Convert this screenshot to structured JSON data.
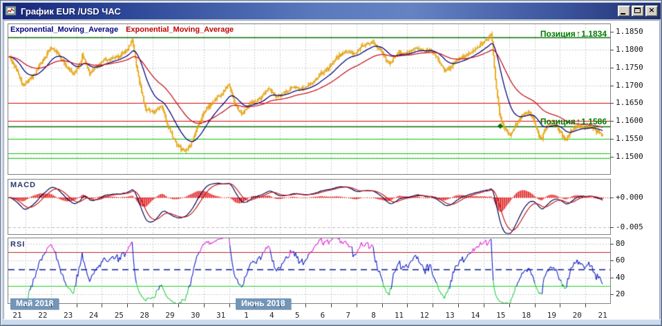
{
  "window": {
    "title": "График EUR /USD ЧАС",
    "close_glyph": "×"
  },
  "legend": {
    "ema_fast_label": "Exponential_Moving_Average",
    "ema_fast_color": "#000080",
    "ema_slow_label": "Exponential_Moving_Average",
    "ema_slow_color": "#c00000"
  },
  "positions": [
    {
      "label": "Позиция",
      "arrow": "↑",
      "price": "1.1834",
      "level": 1.1834,
      "color": "#007a00"
    },
    {
      "label": "Позиция",
      "arrow": "↑",
      "price": "1.1586",
      "level": 1.1586,
      "color": "#007a00",
      "marker": {
        "t": 19.48,
        "shape": "diamond"
      }
    }
  ],
  "chart_data": {
    "type": "candlestick",
    "instrument": "EUR/USD",
    "timeframe": "hourly",
    "title": "График EUR /USD ЧАС",
    "x_axis": {
      "day_labels": [
        "21",
        "22",
        "23",
        "24",
        "25",
        "28",
        "29",
        "30",
        "31",
        "1",
        "4",
        "5",
        "6",
        "7",
        "8",
        "11",
        "12",
        "13",
        "14",
        "15",
        "18",
        "19",
        "20",
        "21"
      ],
      "month_badges": [
        {
          "label": "Май 2018"
        },
        {
          "label": "Июнь 2018"
        }
      ]
    },
    "price_axis": {
      "tick_labels": [
        "1.1850",
        "1.1800",
        "1.1750",
        "1.1700",
        "1.1650",
        "1.1600",
        "1.1550",
        "1.1500"
      ],
      "tick_values": [
        1.185,
        1.18,
        1.175,
        1.17,
        1.165,
        1.16,
        1.155,
        1.15
      ],
      "min_visible": 1.1454,
      "max_visible": 1.1873
    },
    "grid_prices": [
      1.18,
      1.175,
      1.17,
      1.165,
      1.16,
      1.155,
      1.15
    ],
    "hlines": [
      {
        "price": 1.1834,
        "color": "#006b00",
        "width": 1.4
      },
      {
        "price": 1.165,
        "color": "#d40000",
        "width": 1
      },
      {
        "price": 1.1601,
        "color": "#d40000",
        "width": 1
      },
      {
        "price": 1.1586,
        "color": "#006b00",
        "width": 1.4
      },
      {
        "price": 1.1551,
        "color": "#00ca00",
        "width": 1.2
      },
      {
        "price": 1.1509,
        "color": "#00ca00",
        "width": 1.2
      },
      {
        "price": 1.1497,
        "color": "#00ca00",
        "width": 1.2
      }
    ],
    "candle_count": 560,
    "t_start": 0.17,
    "t_end": 23.5,
    "noise_amplitude": 0.0006,
    "wick_amplitude": 0.0007,
    "price_path_waypoints": [
      [
        0.17,
        1.178
      ],
      [
        0.45,
        1.1745
      ],
      [
        0.74,
        1.17
      ],
      [
        0.95,
        1.1716
      ],
      [
        1.2,
        1.1732
      ],
      [
        1.55,
        1.1776
      ],
      [
        1.8,
        1.1806
      ],
      [
        2.1,
        1.179
      ],
      [
        2.4,
        1.1756
      ],
      [
        2.7,
        1.173
      ],
      [
        2.95,
        1.1756
      ],
      [
        3.05,
        1.1788
      ],
      [
        3.35,
        1.1732
      ],
      [
        3.6,
        1.1752
      ],
      [
        3.9,
        1.1772
      ],
      [
        4.2,
        1.1776
      ],
      [
        4.5,
        1.178
      ],
      [
        4.8,
        1.1796
      ],
      [
        5.01,
        1.183
      ],
      [
        5.17,
        1.1758
      ],
      [
        5.36,
        1.169
      ],
      [
        5.55,
        1.1632
      ],
      [
        5.88,
        1.1626
      ],
      [
        6.15,
        1.1645
      ],
      [
        6.36,
        1.16
      ],
      [
        6.58,
        1.156
      ],
      [
        6.8,
        1.1532
      ],
      [
        7.07,
        1.1514
      ],
      [
        7.34,
        1.1536
      ],
      [
        7.61,
        1.1586
      ],
      [
        7.88,
        1.163
      ],
      [
        8.16,
        1.1652
      ],
      [
        8.48,
        1.1672
      ],
      [
        8.81,
        1.1702
      ],
      [
        9.08,
        1.1642
      ],
      [
        9.35,
        1.1618
      ],
      [
        9.68,
        1.1655
      ],
      [
        10.03,
        1.166
      ],
      [
        10.38,
        1.1692
      ],
      [
        10.71,
        1.1666
      ],
      [
        11.03,
        1.168
      ],
      [
        11.36,
        1.1696
      ],
      [
        11.69,
        1.169
      ],
      [
        12.07,
        1.1706
      ],
      [
        12.39,
        1.173
      ],
      [
        12.75,
        1.1752
      ],
      [
        13.1,
        1.178
      ],
      [
        13.42,
        1.1796
      ],
      [
        13.75,
        1.1786
      ],
      [
        14.08,
        1.1812
      ],
      [
        14.46,
        1.1822
      ],
      [
        14.78,
        1.1796
      ],
      [
        15.11,
        1.176
      ],
      [
        15.46,
        1.1792
      ],
      [
        15.81,
        1.1788
      ],
      [
        16.14,
        1.1806
      ],
      [
        16.47,
        1.1796
      ],
      [
        16.82,
        1.1795
      ],
      [
        17.05,
        1.177
      ],
      [
        17.3,
        1.174
      ],
      [
        17.6,
        1.1756
      ],
      [
        17.85,
        1.1776
      ],
      [
        18.1,
        1.1782
      ],
      [
        18.45,
        1.18
      ],
      [
        18.72,
        1.1816
      ],
      [
        18.99,
        1.183
      ],
      [
        19.13,
        1.1846
      ],
      [
        19.23,
        1.1762
      ],
      [
        19.34,
        1.168
      ],
      [
        19.45,
        1.162
      ],
      [
        19.56,
        1.1592
      ],
      [
        19.72,
        1.157
      ],
      [
        19.89,
        1.156
      ],
      [
        20.08,
        1.1592
      ],
      [
        20.35,
        1.1616
      ],
      [
        20.62,
        1.1626
      ],
      [
        20.81,
        1.16
      ],
      [
        20.97,
        1.1562
      ],
      [
        21.08,
        1.1546
      ],
      [
        21.24,
        1.158
      ],
      [
        21.46,
        1.1592
      ],
      [
        21.71,
        1.1586
      ],
      [
        21.9,
        1.156
      ],
      [
        22.06,
        1.1546
      ],
      [
        22.25,
        1.1572
      ],
      [
        22.52,
        1.1586
      ],
      [
        22.79,
        1.158
      ],
      [
        22.98,
        1.1589
      ],
      [
        23.15,
        1.1576
      ],
      [
        23.36,
        1.1566
      ],
      [
        23.5,
        1.156
      ]
    ],
    "ema": {
      "fast_period": 21,
      "slow_period": 55,
      "fast_color": "#00007d",
      "slow_color": "#c41420"
    },
    "macd": {
      "label": "MACD",
      "tick_labels": [
        "+0.000",
        "-0.005"
      ],
      "tick_values": [
        0,
        -0.005
      ],
      "fast": 12,
      "slow": 26,
      "signal": 9,
      "line_color": "#000050",
      "signal_color": "#c01818",
      "hist_color": "#dd0000",
      "zero_line_color": "#dd0000"
    },
    "rsi": {
      "label": "RSI",
      "period": 14,
      "tick_labels": [
        "80",
        "60",
        "40",
        "20"
      ],
      "tick_values": [
        80,
        60,
        40,
        20
      ],
      "levels": [
        {
          "value": 70,
          "color": "#b42222",
          "style": "solid"
        },
        {
          "value": 50,
          "color": "#00148c",
          "style": "dash"
        },
        {
          "value": 30,
          "color": "#22cc22",
          "style": "solid"
        }
      ],
      "line_color": "#0f1ec8",
      "overbought_color": "#e322d6",
      "oversold_color": "#22cc44"
    },
    "colors": {
      "candle": "#eca40a",
      "candle_wick": "#d99a08",
      "grid": "#c9ccd0",
      "panel_border": "#7f7f7f",
      "badge_bg": "#7296b8",
      "titlebar_left": "#16267c",
      "titlebar_mid": "#6583c3"
    }
  }
}
